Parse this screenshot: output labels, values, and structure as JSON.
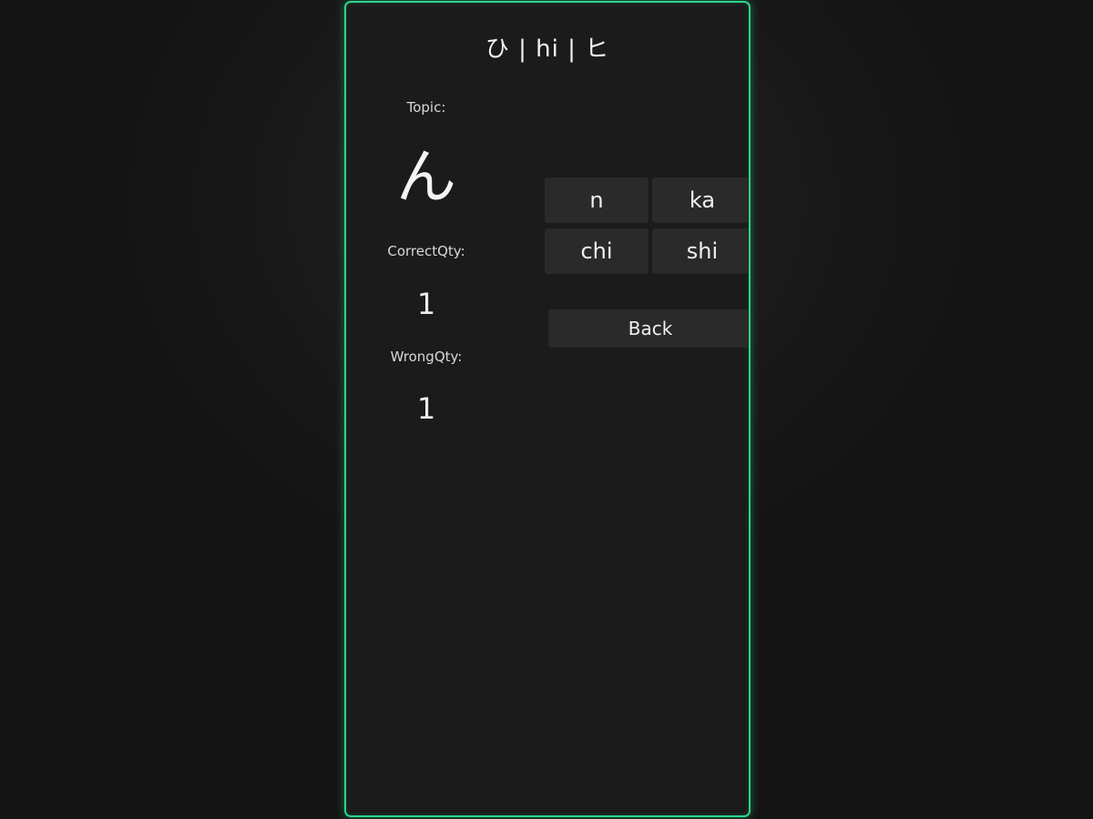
{
  "header": {
    "title": "ひ | hi | ヒ"
  },
  "stats": {
    "topic_label": "Topic:",
    "topic_kana": "ん",
    "correct_label": "CorrectQty:",
    "correct_value": "1",
    "wrong_label": "WrongQty:",
    "wrong_value": "1"
  },
  "answers": [
    "n",
    "ka",
    "chi",
    "shi"
  ],
  "actions": {
    "back_label": "Back"
  },
  "colors": {
    "accent": "#2bd48a",
    "button_bg": "#2a2a2a",
    "panel_bg": "#1b1b1b"
  }
}
